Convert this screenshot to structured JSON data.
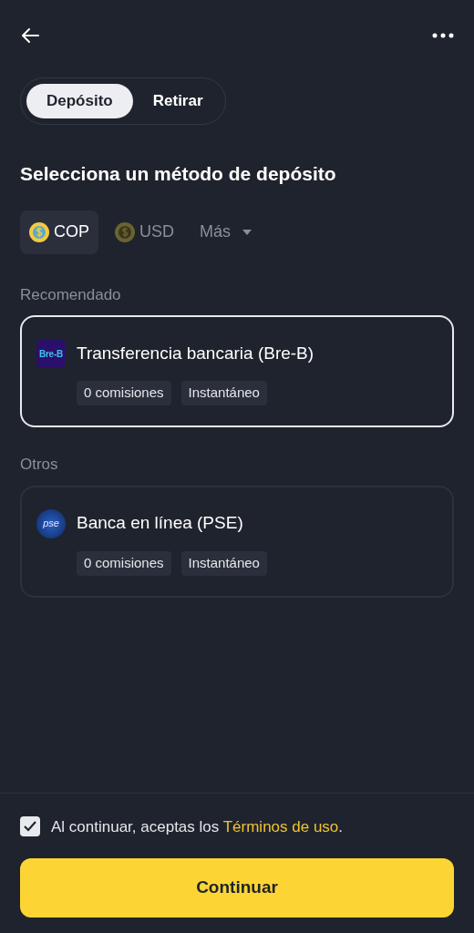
{
  "tabs": [
    {
      "label": "Depósito",
      "selected": true
    },
    {
      "label": "Retirar",
      "selected": false
    }
  ],
  "title": "Selecciona un método de depósito",
  "currencies": [
    {
      "kind": "coin",
      "label": "COP",
      "selected": true
    },
    {
      "kind": "coin",
      "label": "USD",
      "selected": false
    },
    {
      "kind": "dropdown",
      "label": "Más",
      "selected": false
    }
  ],
  "sections": [
    {
      "heading": "Recomendado",
      "methods": [
        {
          "logo": "Bre-B",
          "kind": "breb",
          "name": "Transferencia bancaria (Bre-B)",
          "tags": [
            "0 comisiones",
            "Instantáneo"
          ],
          "selected": true
        }
      ]
    },
    {
      "heading": "Otros",
      "methods": [
        {
          "logo": "pse",
          "kind": "pse",
          "name": "Banca en línea (PSE)",
          "tags": [
            "0 comisiones",
            "Instantáneo"
          ],
          "selected": false
        }
      ]
    }
  ],
  "terms": {
    "checked": true,
    "text": "Al continuar, aceptas los ",
    "link": "Términos de uso",
    "after": "."
  },
  "button": "Continuar"
}
